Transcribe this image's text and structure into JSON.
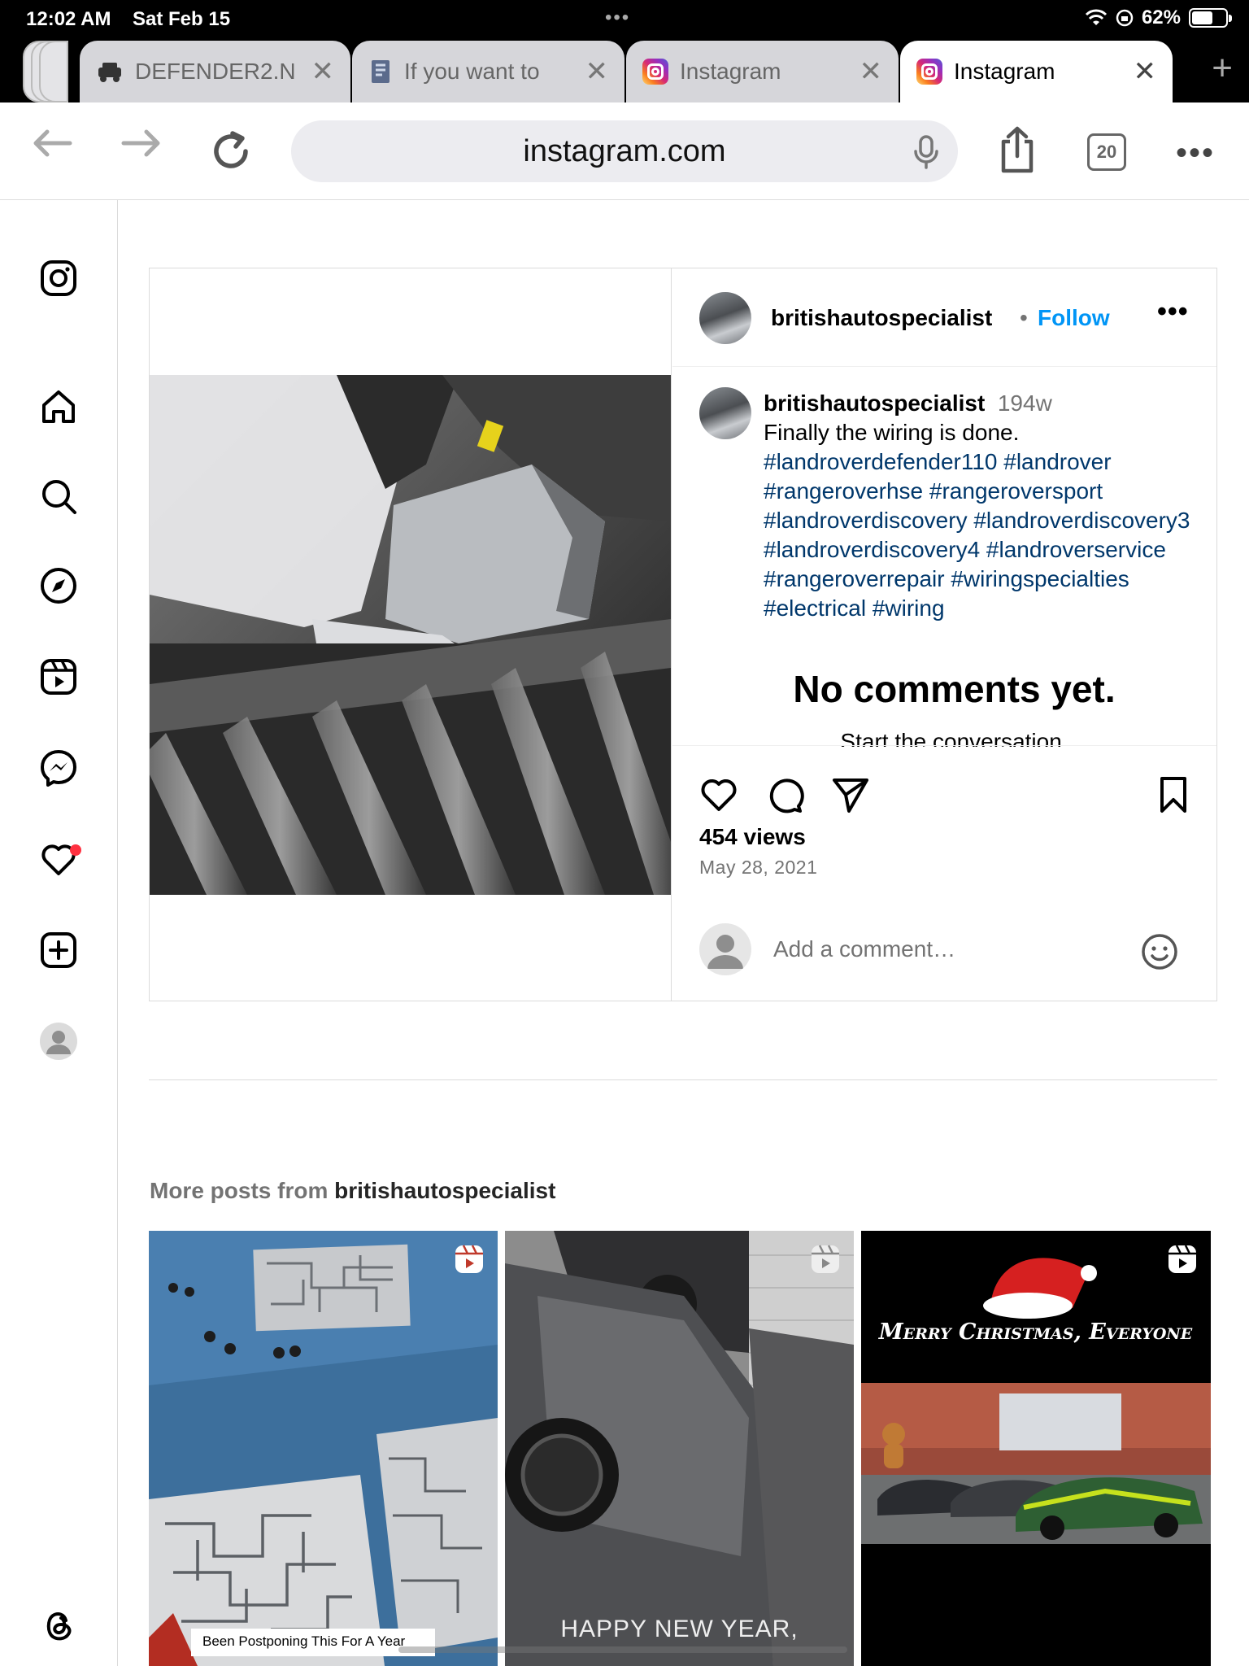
{
  "status": {
    "time": "12:02 AM",
    "date": "Sat Feb 15",
    "battery": "62%",
    "battery_level": 0.62
  },
  "tabs": [
    {
      "title": "DEFENDER2.N",
      "active": false
    },
    {
      "title": "If you want to",
      "active": false
    },
    {
      "title": "Instagram",
      "active": false
    },
    {
      "title": "Instagram",
      "active": true
    }
  ],
  "toolbar": {
    "url": "instagram.com",
    "tab_count": "20"
  },
  "post": {
    "username": "britishautospecialist",
    "follow_label": "Follow",
    "caption_user": "britishautospecialist",
    "age": "194w",
    "caption_text": "Finally the wiring is done.",
    "hashtags": "#landroverdefender110 #landrover #rangeroverhse #rangeroversport #landroverdiscovery #landroverdiscovery3 #landroverdiscovery4 #landroverservice #rangeroverrepair #wiringspecialties #electrical #wiring",
    "no_comments": "No comments yet.",
    "start_conversation": "Start the conversation.",
    "views": "454 views",
    "date": "May 28, 2021",
    "comment_placeholder": "Add a comment…"
  },
  "more_posts": {
    "prefix": "More posts from",
    "username": "britishautospecialist",
    "items": [
      {
        "caption": "Been Postponing This For A Year"
      },
      {
        "caption": "HAPPY NEW YEAR,"
      },
      {
        "caption": "Merry Christmas, Everyone"
      }
    ]
  },
  "colors": {
    "accent": "#0095f6",
    "hashtag": "#00376b",
    "notification": "#ff3040"
  },
  "icons": [
    "instagram-logo-icon",
    "home-icon",
    "search-icon",
    "explore-icon",
    "reels-icon",
    "messenger-icon",
    "heart-icon",
    "create-icon",
    "profile-icon",
    "threads-icon"
  ]
}
